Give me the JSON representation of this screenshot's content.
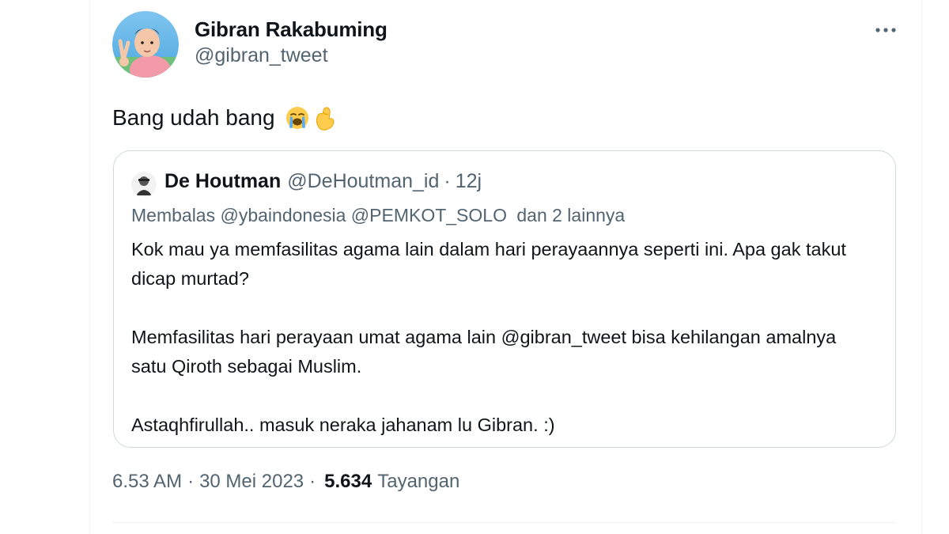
{
  "tweet": {
    "author": {
      "name": "Gibran Rakabuming",
      "handle": "@gibran_tweet",
      "avatar": "profile-photo"
    },
    "text": "Bang udah bang",
    "emojis": [
      "loudly-crying-face",
      "pinching-hand"
    ],
    "more_icon": "more-horizontal-icon",
    "timestamp": {
      "time": "6.53 AM",
      "separator": "·",
      "date": "30 Mei 2023",
      "views_count": "5.634",
      "views_label": "Tayangan"
    }
  },
  "quoted_tweet": {
    "name": "De Houtman",
    "handle": "@DeHoutman_id",
    "separator": "·",
    "time": "12j",
    "reply": {
      "prefix": "Membalas",
      "mentions": "@ybaindonesia @PEMKOT_SOLO",
      "suffix": "dan 2 lainnya"
    },
    "paragraphs": [
      "Kok mau ya memfasilitas agama lain dalam hari perayaannya seperti ini. Apa gak takut dicap murtad?",
      "Memfasilitas hari perayaan umat agama lain @gibran_tweet bisa kehilangan amalnya satu Qiroth sebagai Muslim.",
      "Astaqhfirullah.. masuk neraka jahanam lu Gibran. :)"
    ]
  },
  "colors": {
    "text_primary": "#0f1419",
    "text_secondary": "#536471",
    "border": "#cfd9de"
  }
}
